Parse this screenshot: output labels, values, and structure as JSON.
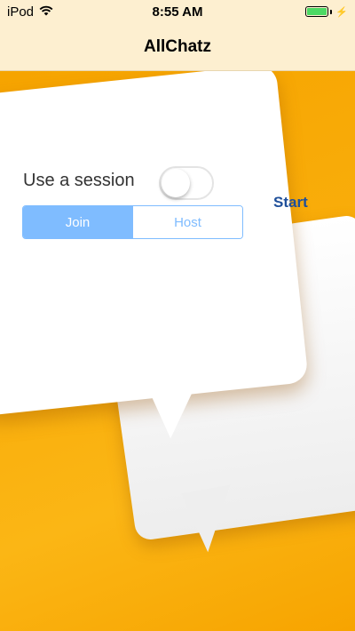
{
  "status_bar": {
    "carrier": "iPod",
    "time": "8:55 AM"
  },
  "nav": {
    "title": "AllChatz"
  },
  "session": {
    "label": "Use a session",
    "toggle_on": false
  },
  "start_label": "Start",
  "segments": [
    {
      "label": "Join",
      "selected": true
    },
    {
      "label": "Host",
      "selected": false
    }
  ],
  "colors": {
    "accent": "#7fbcff",
    "start": "#1f4f9a",
    "background": "#f9ad0a"
  },
  "icons": {
    "wifi": "wifi-icon",
    "battery": "battery-icon",
    "charging": "charging-bolt-icon"
  }
}
